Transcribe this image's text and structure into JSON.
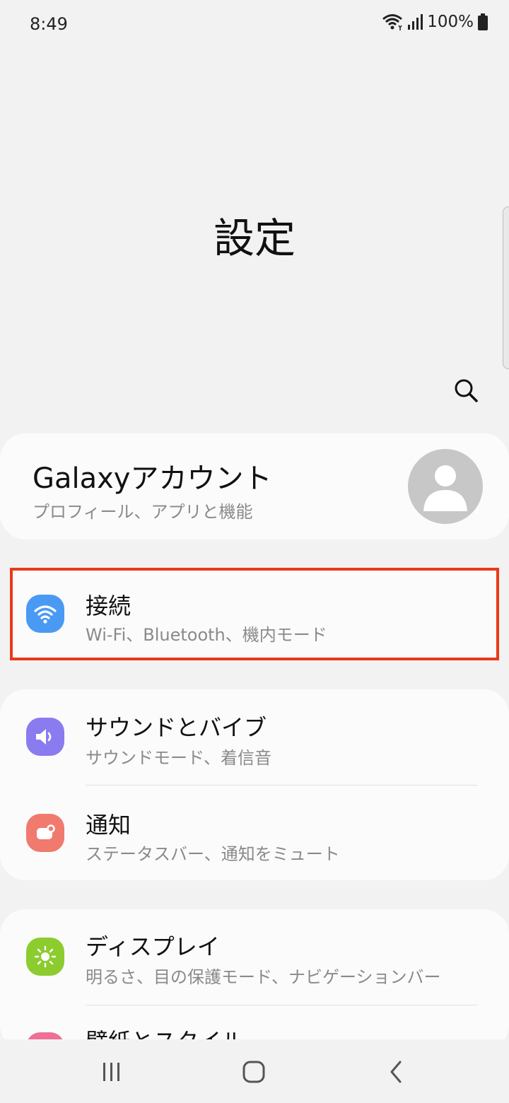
{
  "status_bar": {
    "time": "8:49",
    "battery_text": "100%",
    "icons": [
      "wifi-icon",
      "signal-icon",
      "battery-icon"
    ]
  },
  "header": {
    "title": "設定",
    "search_icon": "search-icon"
  },
  "account": {
    "title": "Galaxyアカウント",
    "subtitle": "プロフィール、アプリと機能",
    "avatar_icon": "person-icon"
  },
  "items": [
    {
      "title": "接続",
      "subtitle": "Wi-Fi、Bluetooth、機内モード",
      "icon": "wifi-icon",
      "color": "#4a9af4",
      "highlighted": true,
      "highlight_color": "#e8391b"
    },
    {
      "title": "サウンドとバイブ",
      "subtitle": "サウンドモード、着信音",
      "icon": "speaker-icon",
      "color": "#8b7bf0"
    },
    {
      "title": "通知",
      "subtitle": "ステータスバー、通知をミュート",
      "icon": "notification-icon",
      "color": "#f07a6e"
    },
    {
      "title": "ディスプレイ",
      "subtitle": "明るさ、目の保護モード、ナビゲーションバー",
      "icon": "brightness-icon",
      "color": "#8ccc2e"
    },
    {
      "title": "壁紙とスタイル",
      "icon": "wallpaper-icon",
      "color": "#ef6f97"
    }
  ],
  "nav_bar": {
    "buttons": [
      "recent-apps-icon",
      "home-icon",
      "back-icon"
    ]
  }
}
